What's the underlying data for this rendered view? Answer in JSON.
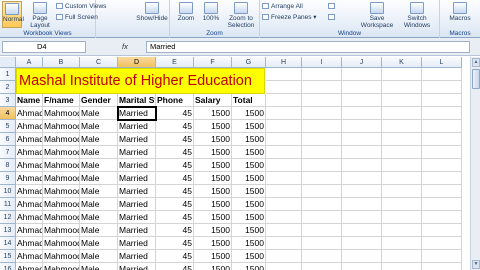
{
  "ribbon": {
    "normal_label": "Normal",
    "page_layout_label": "Page Layout",
    "custom_views_label": "Custom Views",
    "full_screen_label": "Full Screen",
    "workbook_views_group": "Workbook Views",
    "show_hide_label": "Show/Hide",
    "zoom_label": "Zoom",
    "zoom_100_label": "100%",
    "zoom_selection_label": "Zoom to Selection",
    "zoom_group": "Zoom",
    "arrange_all_label": "Arrange All",
    "freeze_panes_label": "Freeze Panes",
    "save_workspace_label": "Save Workspace",
    "switch_windows_label": "Switch Windows",
    "window_group": "Window",
    "macros_label": "Macros",
    "macros_group": "Macros"
  },
  "formula_bar": {
    "name_box": "D4",
    "fx": "fx",
    "value": "Married"
  },
  "sheet": {
    "columns": [
      "A",
      "B",
      "C",
      "D",
      "E",
      "F",
      "G",
      "H",
      "I",
      "J",
      "K",
      "L"
    ],
    "selected_column": "D",
    "selected_row": 4,
    "rows": [
      1,
      2,
      3,
      4,
      5,
      6,
      7,
      8,
      9,
      10,
      11,
      12,
      13,
      14,
      15,
      16
    ],
    "title": "Mashal Institute of Higher Education",
    "headers": [
      "Name",
      "F/name",
      "Gender",
      "Marital St",
      "Phone",
      "Salary",
      "Total"
    ],
    "data": [
      [
        "Ahmad",
        "Mahmood",
        "Male",
        "Married",
        "45",
        "1500",
        "1500"
      ],
      [
        "Ahmad",
        "Mahmood",
        "Male",
        "Married",
        "45",
        "1500",
        "1500"
      ],
      [
        "Ahmad",
        "Mahmood",
        "Male",
        "Married",
        "45",
        "1500",
        "1500"
      ],
      [
        "Ahmad",
        "Mahmood",
        "Male",
        "Married",
        "45",
        "1500",
        "1500"
      ],
      [
        "Ahmad",
        "Mahmood",
        "Male",
        "Married",
        "45",
        "1500",
        "1500"
      ],
      [
        "Ahmad",
        "Mahmood",
        "Male",
        "Married",
        "45",
        "1500",
        "1500"
      ],
      [
        "Ahmad",
        "Mahmood",
        "Male",
        "Married",
        "45",
        "1500",
        "1500"
      ],
      [
        "Ahmad",
        "Mahmood",
        "Male",
        "Married",
        "45",
        "1500",
        "1500"
      ],
      [
        "Ahmad",
        "Mahmood",
        "Male",
        "Married",
        "45",
        "1500",
        "1500"
      ],
      [
        "Ahmad",
        "Mahmood",
        "Male",
        "Married",
        "45",
        "1500",
        "1500"
      ],
      [
        "Ahmad",
        "Mahmood",
        "Male",
        "Married",
        "45",
        "1500",
        "1500"
      ],
      [
        "Ahmad",
        "Mahmood",
        "Male",
        "Married",
        "45",
        "1500",
        "1500"
      ],
      [
        "Ahmad",
        "Mahmood",
        "Male",
        "Married",
        "45",
        "1500",
        "1500"
      ]
    ]
  },
  "colors": {
    "title_fill": "#ffff00",
    "title_text": "#c00000",
    "selected_header": "#f1c15f"
  }
}
